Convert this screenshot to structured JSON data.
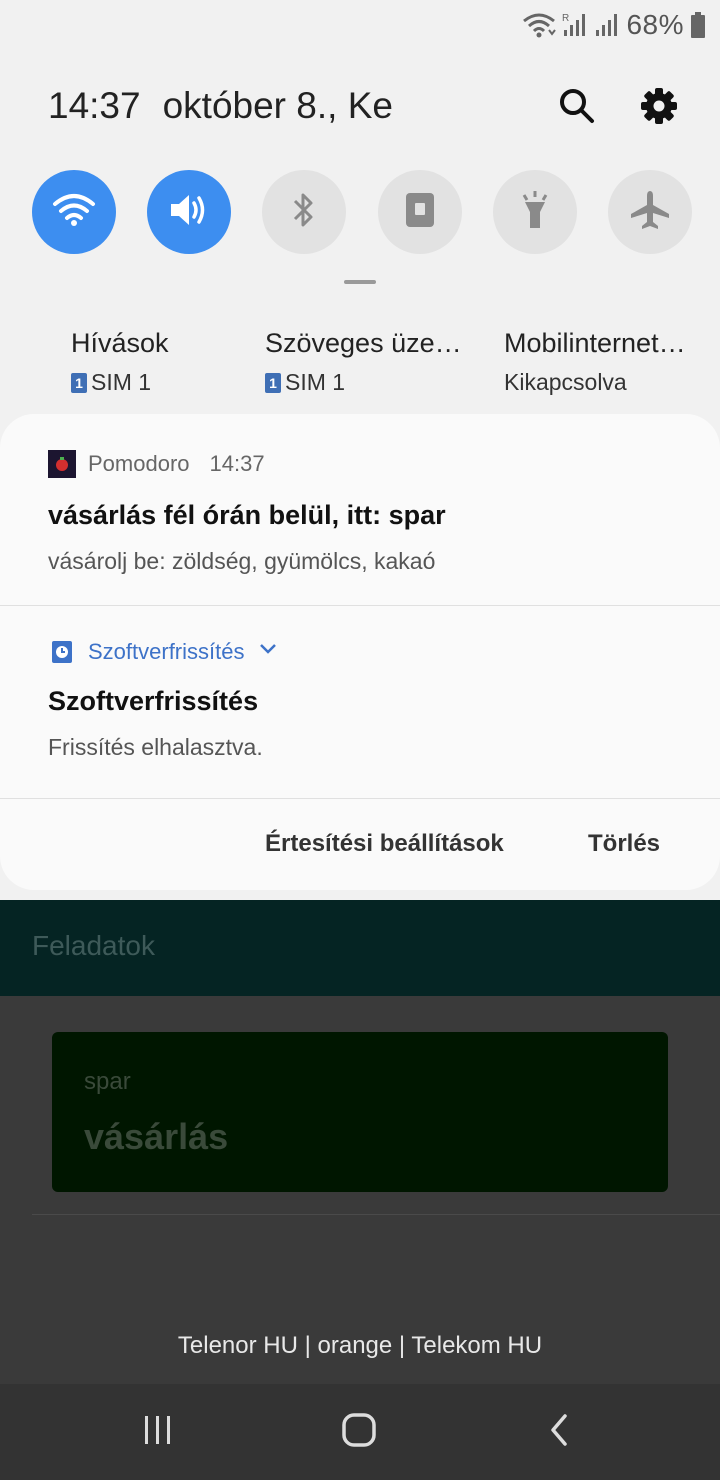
{
  "status": {
    "battery": "68%"
  },
  "header": {
    "time": "14:37",
    "date": "október 8., Ke"
  },
  "quick_settings": [
    {
      "name": "wifi",
      "state": "on"
    },
    {
      "name": "sound",
      "state": "on"
    },
    {
      "name": "bluetooth",
      "state": "off"
    },
    {
      "name": "rotation-lock",
      "state": "off"
    },
    {
      "name": "flashlight",
      "state": "off"
    },
    {
      "name": "airplane-mode",
      "state": "off"
    }
  ],
  "sim_info": [
    {
      "title": "Hívások",
      "sub": "SIM 1",
      "badge": "1"
    },
    {
      "title": "Szöveges üze…",
      "sub": "SIM 1",
      "badge": "1"
    },
    {
      "title": "Mobilinternet…",
      "sub": "Kikapcsolva"
    }
  ],
  "notifications": [
    {
      "app": "Pomodoro",
      "time": "14:37",
      "title": "vásárlás fél órán belül, itt: spar",
      "text": "vásárolj be: zöldség, gyümölcs, kakaó"
    },
    {
      "app": "Szoftverfrissítés",
      "title": "Szoftverfrissítés",
      "text": "Frissítés elhalasztva."
    }
  ],
  "actions": {
    "settings": "Értesítési beállítások",
    "clear": "Törlés"
  },
  "app": {
    "toolbar_title": "Feladatok",
    "task": {
      "subtitle": "spar",
      "title": "vásárlás"
    }
  },
  "carriers": "Telenor HU | orange | Telekom HU",
  "colors": {
    "accent": "#3d8ef0",
    "toolbar": "#052423",
    "task_card": "#001600"
  }
}
